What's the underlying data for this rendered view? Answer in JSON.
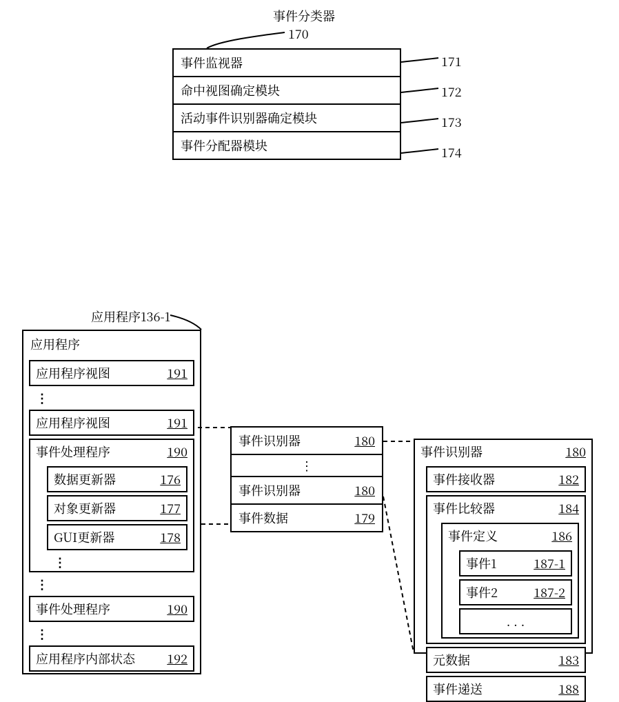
{
  "classifier": {
    "title": "事件分类器",
    "ref": "170",
    "rows": [
      {
        "label": "事件监视器",
        "ref": "171"
      },
      {
        "label": "命中视图确定模块",
        "ref": "172"
      },
      {
        "label": "活动事件识别器确定模块",
        "ref": "173"
      },
      {
        "label": "事件分配器模块",
        "ref": "174"
      }
    ]
  },
  "application": {
    "title": "应用程序",
    "title_ref": "136-1",
    "header": "应用程序",
    "items": {
      "app_view": {
        "label": "应用程序视图",
        "ref": "191"
      },
      "app_view2": {
        "label": "应用程序视图",
        "ref": "191"
      },
      "event_handler": {
        "label": "事件处理程序",
        "ref": "190"
      },
      "data_updater": {
        "label": "数据更新器",
        "ref": "176"
      },
      "object_updater": {
        "label": "对象更新器",
        "ref": "177"
      },
      "gui_updater": {
        "label": "GUI更新器",
        "ref": "178"
      },
      "event_handler2": {
        "label": "事件处理程序",
        "ref": "190"
      },
      "internal_state": {
        "label": "应用程序内部状态",
        "ref": "192"
      }
    }
  },
  "recognizer_list": {
    "rows": {
      "r1": {
        "label": "事件识别器",
        "ref": "180"
      },
      "r2": {
        "label": "事件识别器",
        "ref": "180"
      },
      "data": {
        "label": "事件数据",
        "ref": "179"
      }
    }
  },
  "recognizer_detail": {
    "header": {
      "label": "事件识别器",
      "ref": "180"
    },
    "receiver": {
      "label": "事件接收器",
      "ref": "182"
    },
    "comparator": {
      "label": "事件比较器",
      "ref": "184"
    },
    "definition": {
      "label": "事件定义",
      "ref": "186"
    },
    "event1": {
      "label": "事件1",
      "ref": "187-1"
    },
    "event2": {
      "label": "事件2",
      "ref": "187-2"
    },
    "metadata": {
      "label": "元数据",
      "ref": "183"
    },
    "delivery": {
      "label": "事件递送",
      "ref": "188"
    }
  },
  "ellipsis": ". . .",
  "ellipsis_v": "⋮"
}
